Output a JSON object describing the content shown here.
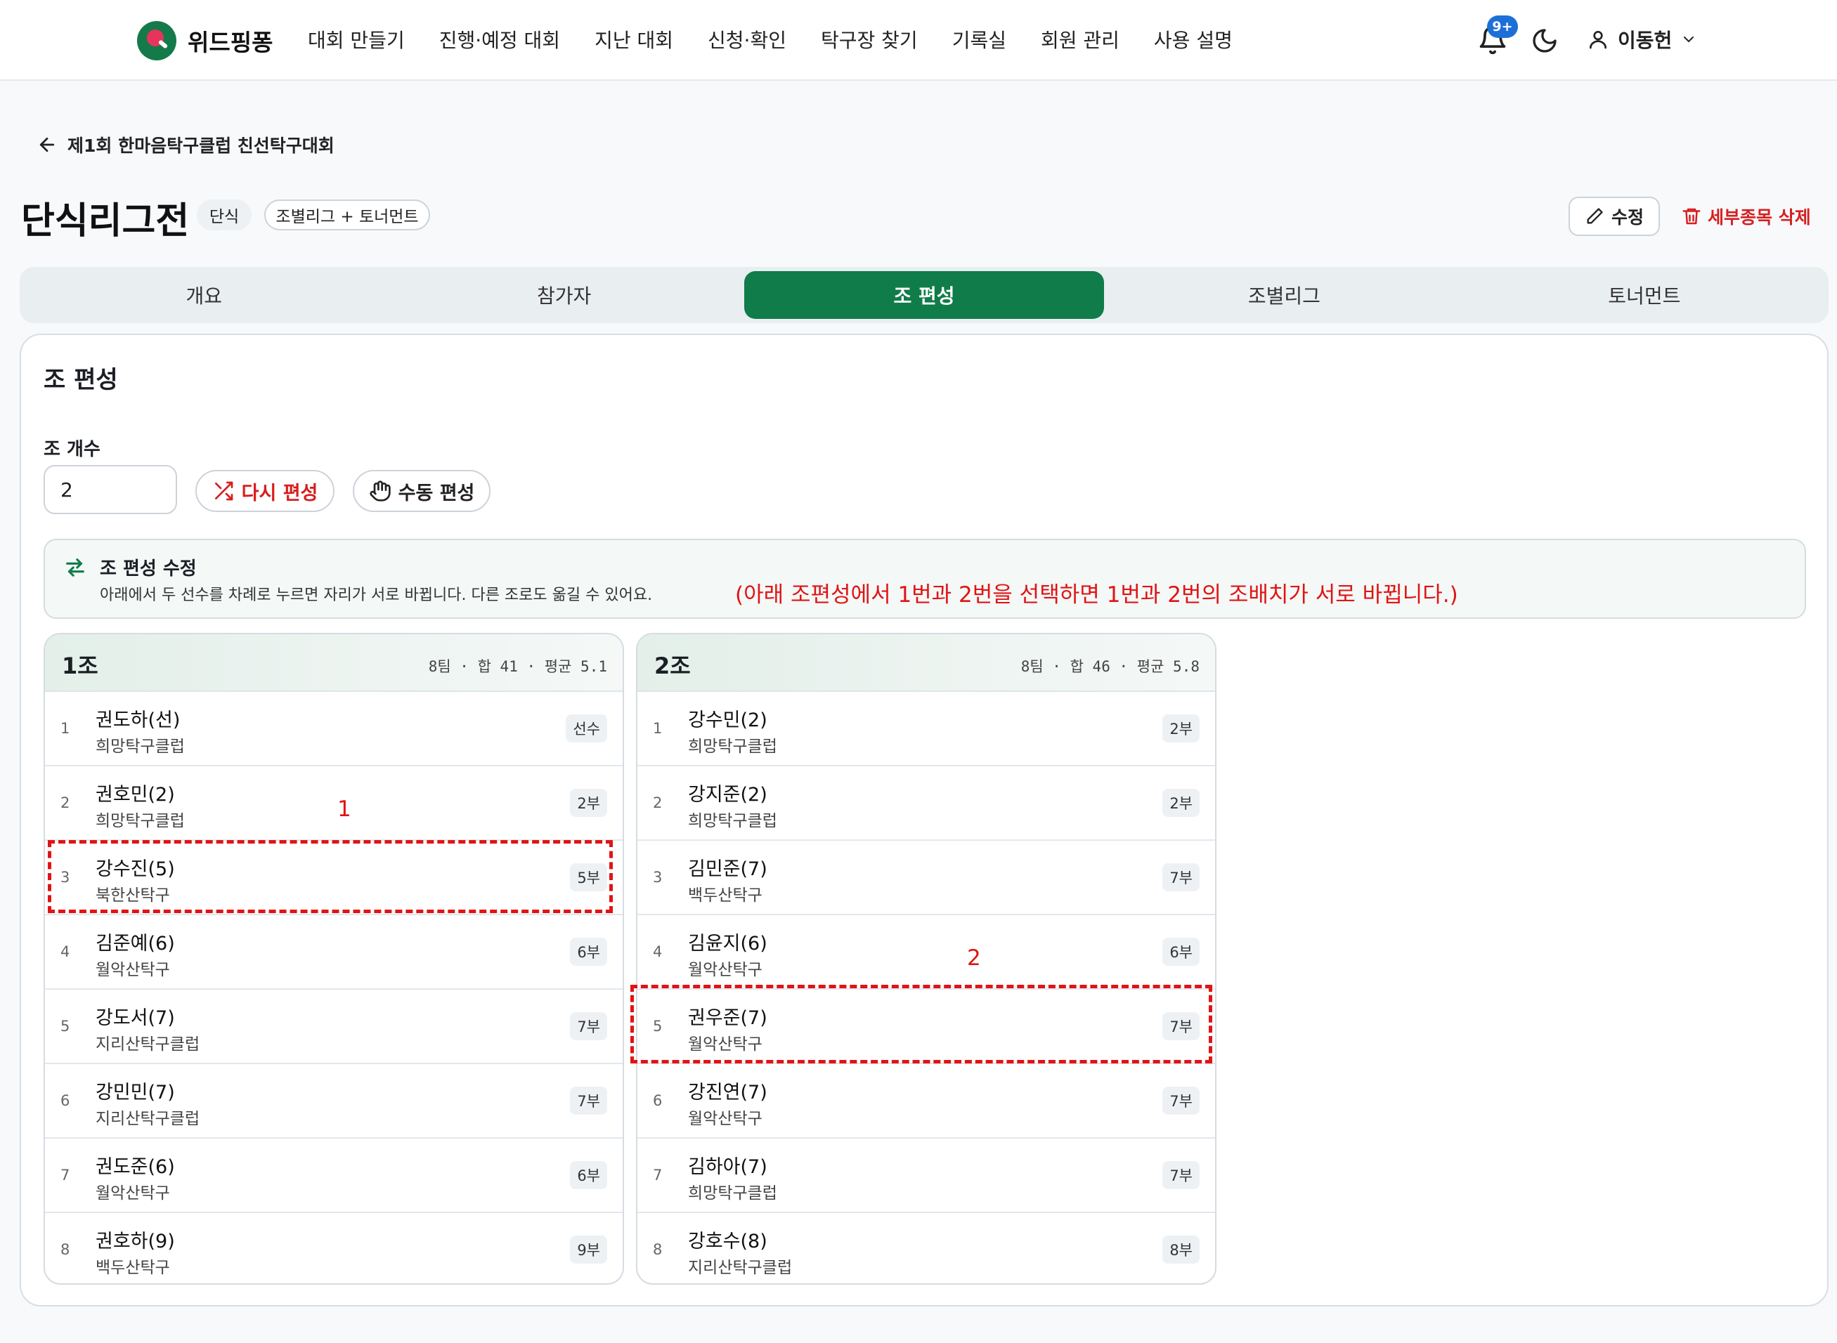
{
  "app": {
    "logo_text": "위드핑퐁",
    "nav": [
      "대회 만들기",
      "진행·예정 대회",
      "지난 대회",
      "신청·확인",
      "탁구장 찾기",
      "기록실",
      "회원 관리",
      "사용 설명"
    ],
    "notification_badge": "9+",
    "user_name": "이동헌"
  },
  "header": {
    "back_label": "제1회 한마음탁구클럽 친선탁구대회",
    "title": "단식리그전",
    "chip_type": "단식",
    "chip_format": "조별리그 + 토너먼트",
    "edit_label": "수정",
    "delete_label": "세부종목 삭제"
  },
  "tabs": [
    {
      "label": "개요",
      "active": false
    },
    {
      "label": "참가자",
      "active": false
    },
    {
      "label": "조 편성",
      "active": true
    },
    {
      "label": "조별리그",
      "active": false
    },
    {
      "label": "토너먼트",
      "active": false
    }
  ],
  "main": {
    "section_title": "조 편성",
    "count_label": "조 개수",
    "count_value": "2",
    "reshuffle_label": "다시 편성",
    "manual_label": "수동 편성",
    "info_title": "조 편성 수정",
    "info_text": "아래에서 두 선수를 차례로 누르면 자리가 서로 바뀝니다. 다른 조로도 옮길 수 있어요.",
    "info_note": "(아래 조편성에서 1번과 2번을 선택하면 1번과 2번의 조배치가 서로 바뀝니다.)"
  },
  "groups": [
    {
      "name": "1조",
      "stats": "8팀 · 합 41 · 평균 5.1",
      "players": [
        {
          "no": "1",
          "name": "권도하(선)",
          "club": "희망탁구클럽",
          "grade": "선수"
        },
        {
          "no": "2",
          "name": "권호민(2)",
          "club": "희망탁구클럽",
          "grade": "2부"
        },
        {
          "no": "3",
          "name": "강수진(5)",
          "club": "북한산탁구",
          "grade": "5부"
        },
        {
          "no": "4",
          "name": "김준예(6)",
          "club": "월악산탁구",
          "grade": "6부"
        },
        {
          "no": "5",
          "name": "강도서(7)",
          "club": "지리산탁구클럽",
          "grade": "7부"
        },
        {
          "no": "6",
          "name": "강민민(7)",
          "club": "지리산탁구클럽",
          "grade": "7부"
        },
        {
          "no": "7",
          "name": "권도준(6)",
          "club": "월악산탁구",
          "grade": "6부"
        },
        {
          "no": "8",
          "name": "권호하(9)",
          "club": "백두산탁구",
          "grade": "9부"
        }
      ]
    },
    {
      "name": "2조",
      "stats": "8팀 · 합 46 · 평균 5.8",
      "players": [
        {
          "no": "1",
          "name": "강수민(2)",
          "club": "희망탁구클럽",
          "grade": "2부"
        },
        {
          "no": "2",
          "name": "강지준(2)",
          "club": "희망탁구클럽",
          "grade": "2부"
        },
        {
          "no": "3",
          "name": "김민준(7)",
          "club": "백두산탁구",
          "grade": "7부"
        },
        {
          "no": "4",
          "name": "김윤지(6)",
          "club": "월악산탁구",
          "grade": "6부"
        },
        {
          "no": "5",
          "name": "권우준(7)",
          "club": "월악산탁구",
          "grade": "7부"
        },
        {
          "no": "6",
          "name": "강진연(7)",
          "club": "월악산탁구",
          "grade": "7부"
        },
        {
          "no": "7",
          "name": "김하아(7)",
          "club": "희망탁구클럽",
          "grade": "7부"
        },
        {
          "no": "8",
          "name": "강호수(8)",
          "club": "지리산탁구클럽",
          "grade": "8부"
        }
      ]
    }
  ],
  "annotations": {
    "marker_1": "1",
    "marker_2": "2"
  },
  "colors": {
    "accent": "#0f7c4a",
    "danger": "#d71e1e",
    "annotation": "#e01414",
    "badge": "#1d6fd8"
  }
}
